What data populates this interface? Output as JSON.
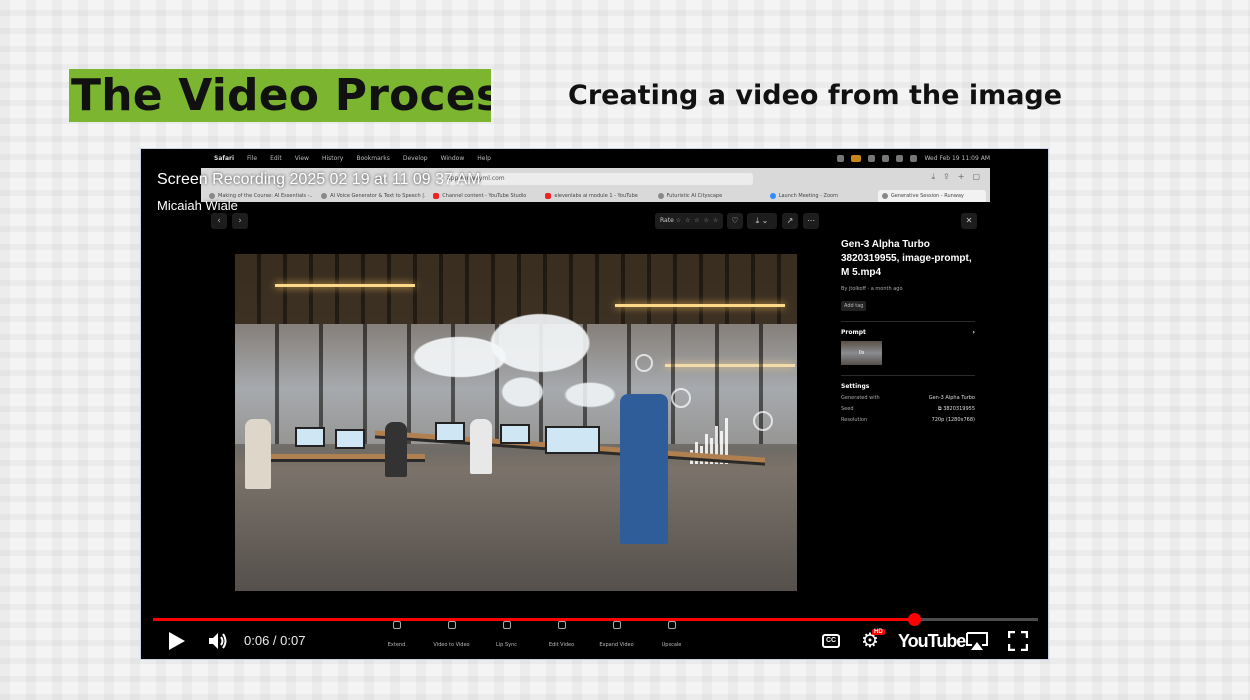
{
  "slide": {
    "title": "The Video Process",
    "subtitle": "Creating a video from the image",
    "title_bg_color": "#7cb52f"
  },
  "youtube": {
    "video_title": "Screen Recording 2025 02 19 at 11 09 37 AM",
    "channel": "Micaiah Wiale",
    "current_time": "0:06 / 0:07",
    "progress": 0.86,
    "logo_text": "YouTube",
    "hd_badge": "HD",
    "cc_label": "CC"
  },
  "mac_menubar": {
    "app": "Safari",
    "items": [
      "File",
      "Edit",
      "View",
      "History",
      "Bookmarks",
      "Develop",
      "Window",
      "Help"
    ],
    "clock": "Wed Feb 19 11:09 AM"
  },
  "browser": {
    "url": "app.runwayml.com",
    "tabs": [
      "Making of the Course: AI Essentials -...",
      "AI Voice Generator & Text to Speech |...",
      "Channel content - YouTube Studio",
      "elevenlabs ai module 1 - YouTube",
      "Futuristic AI Cityscape",
      "Launch Meeting - Zoom",
      "Generative Session - Runway"
    ]
  },
  "runway": {
    "rate_label": "Rate",
    "stars": "☆ ☆ ☆ ☆ ☆",
    "info": {
      "title": "Gen-3 Alpha Turbo 3820319955, image-prompt, M 5.mp4",
      "meta": "By jtolkoff · a month ago",
      "add_tag": "Add tag",
      "prompt_heading": "Prompt",
      "prompt_thumb": "0s",
      "settings_heading": "Settings",
      "settings": [
        {
          "label": "Generated with",
          "value": "Gen-3 Alpha Turbo"
        },
        {
          "label": "Seed",
          "value": "3820319955"
        },
        {
          "label": "Resolution",
          "value": "720p (1280x768)"
        }
      ]
    },
    "bottom_tools": [
      "Extend",
      "Video to Video",
      "Lip Sync",
      "Edit Video",
      "Expand Video",
      "Upscale"
    ]
  }
}
